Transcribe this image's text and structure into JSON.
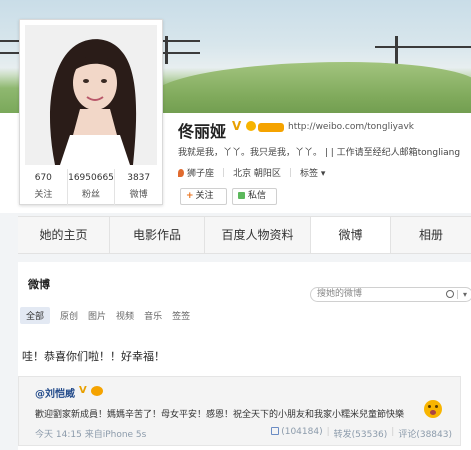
{
  "profile": {
    "name": "佟丽娅",
    "url": "http://weibo.com/tongliyavk",
    "bio": "我就是我，丫丫。我只是我，丫丫。 | | 工作请至经纪人邮箱tongliang",
    "zodiac": "狮子座",
    "location": "北京 朝阳区",
    "tags_label": "标签",
    "follow_label": "关注",
    "message_label": "私信",
    "stats": [
      {
        "num": "670",
        "label": "关注"
      },
      {
        "num": "16950665",
        "label": "粉丝"
      },
      {
        "num": "3837",
        "label": "微博"
      }
    ]
  },
  "tabs": [
    {
      "label": "她的主页"
    },
    {
      "label": "电影作品"
    },
    {
      "label": "百度人物资料"
    },
    {
      "label": "微博"
    },
    {
      "label": "相册"
    }
  ],
  "feed": {
    "title": "微博",
    "search_placeholder": "搜她的微博",
    "filters": [
      "全部",
      "原创",
      "图片",
      "视频",
      "音乐",
      "签签"
    ],
    "post_text": "哇！恭喜你们啦！！好幸福！",
    "repost": {
      "author": "@刘恺威",
      "text": "歡迎劉家新成員！媽媽辛苦了！母女平安！感恩！祝全天下的小朋友和我家小糯米兒童節快樂",
      "time": "今天 14:15",
      "source": "来自iPhone 5s",
      "likes": "(104184)",
      "reposts": "转发(53536)",
      "comments": "评论(38843)"
    }
  },
  "colors": {
    "accent": "#e8701a",
    "link": "#224a8a",
    "meta": "#8c9bab"
  }
}
